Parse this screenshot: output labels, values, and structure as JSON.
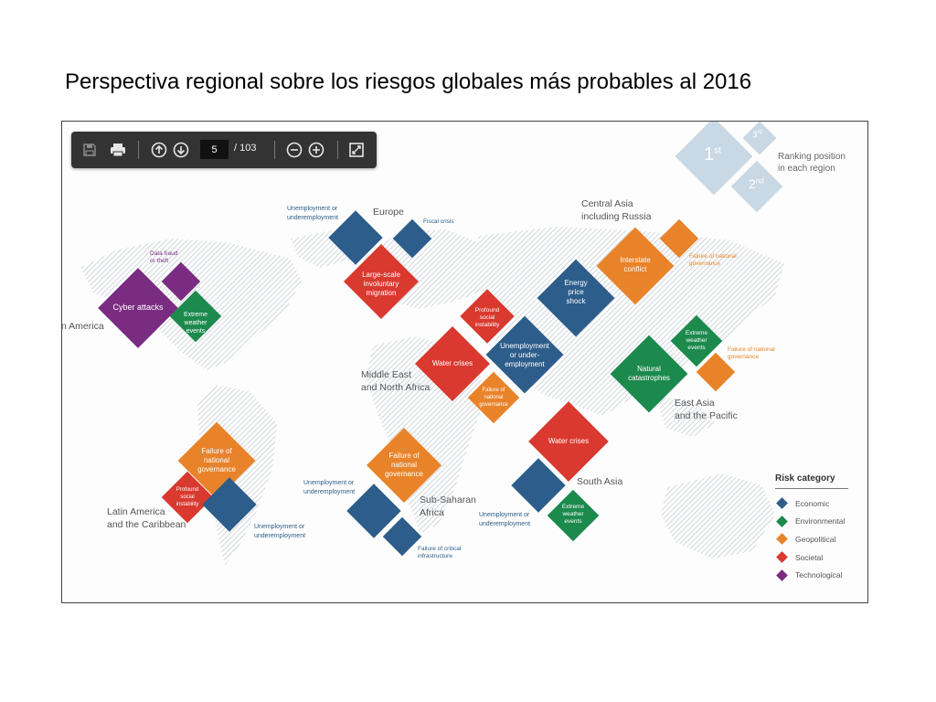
{
  "slide": {
    "title": "Perspectiva regional sobre los riesgos globales más probables al 2016"
  },
  "toolbar": {
    "save_icon": "save-icon",
    "print_icon": "printer-icon",
    "up_icon": "arrow-up-icon",
    "down_icon": "arrow-down-icon",
    "page_current": "5",
    "page_total": "/ 103",
    "zoom_out_icon": "zoom-out-icon",
    "zoom_in_icon": "zoom-in-icon",
    "fit_icon": "fit-page-icon"
  },
  "colors": {
    "economic": "#2d5d8a",
    "environmental": "#1c8a4d",
    "geopolitical": "#e8832a",
    "societal": "#d9392f",
    "technological": "#7a2c82",
    "rank_key": "#c8d8e4"
  },
  "ranking_key": {
    "first": "1",
    "first_sup": "st",
    "second": "2",
    "second_sup": "nd",
    "third": "3",
    "third_sup": "rd",
    "caption_line1": "Ranking position",
    "caption_line2": "in each region"
  },
  "regions": {
    "europe": "Europe",
    "central_asia_1": "Central Asia",
    "central_asia_2": "including Russia",
    "north_america": "n America",
    "mena_1": "Middle East",
    "mena_2": "and North Africa",
    "east_asia_1": "East Asia",
    "east_asia_2": "and the Pacific",
    "south_asia": "South Asia",
    "latam_1": "Latin America",
    "latam_2": "and the Caribbean",
    "ssa_1": "Sub-Saharan",
    "ssa_2": "Africa"
  },
  "risks": {
    "na_cyber": "Cyber attacks",
    "na_weather_1": "Extreme",
    "na_weather_2": "weather",
    "na_weather_3": "events",
    "na_fraud_1": "Data fraud",
    "na_fraud_2": "or theft",
    "eu_unemp_1": "Unemployment or",
    "eu_unemp_2": "underemployment",
    "eu_fiscal": "Fiscal crisis",
    "eu_migration_1": "Large-scale",
    "eu_migration_2": "involuntary",
    "eu_migration_3": "migration",
    "ca_energy_1": "Energy",
    "ca_energy_2": "price",
    "ca_energy_3": "shock",
    "ca_conflict_1": "Interstate",
    "ca_conflict_2": "conflict",
    "ca_gov_1": "Failure of national",
    "ca_gov_2": "governance",
    "me_water": "Water crises",
    "me_unemp_1": "Unemployment",
    "me_unemp_2": "or under-",
    "me_unemp_3": "employment",
    "me_instab_1": "Profound",
    "me_instab_2": "social",
    "me_instab_3": "instability",
    "me_gov_1": "Failure of",
    "me_gov_2": "national",
    "me_gov_3": "governance",
    "ea_nat_1": "Natural",
    "ea_nat_2": "catastrophes",
    "ea_weather_1": "Extreme",
    "ea_weather_2": "weather",
    "ea_weather_3": "events",
    "ea_gov_1": "Failure of national",
    "ea_gov_2": "governance",
    "sa_water": "Water crises",
    "sa_weather_1": "Extreme",
    "sa_weather_2": "weather",
    "sa_weather_3": "events",
    "sa_unemp_1": "Unemployment or",
    "sa_unemp_2": "underemployment",
    "la_gov_1": "Failure of",
    "la_gov_2": "national",
    "la_gov_3": "governance",
    "la_instab_1": "Profound",
    "la_instab_2": "social",
    "la_instab_3": "instability",
    "la_unemp_1": "Unemployment or",
    "la_unemp_2": "underemployment",
    "ssa_gov_1": "Failure of",
    "ssa_gov_2": "national",
    "ssa_gov_3": "governance",
    "ssa_unemp_1": "Unemployment or",
    "ssa_unemp_2": "underemployment",
    "ssa_infra_1": "Failure of critical",
    "ssa_infra_2": "infrastructure"
  },
  "legend": {
    "title": "Risk category",
    "items": [
      {
        "label": "Economic",
        "color": "#2d5d8a"
      },
      {
        "label": "Environmental",
        "color": "#1c8a4d"
      },
      {
        "label": "Geopolitical",
        "color": "#e8832a"
      },
      {
        "label": "Societal",
        "color": "#d9392f"
      },
      {
        "label": "Technological",
        "color": "#7a2c82"
      }
    ]
  }
}
